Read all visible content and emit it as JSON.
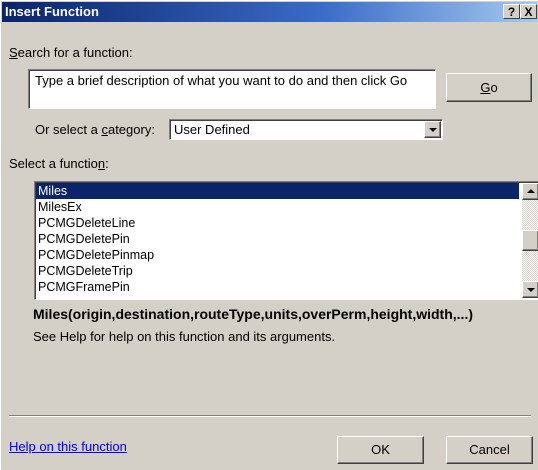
{
  "dialog": {
    "title": "Insert Function",
    "help_btn": "?",
    "close_btn": "X"
  },
  "search": {
    "label_accel": "S",
    "label_rest": "earch for a function:",
    "text": "Type a brief description of what you want to do and then click Go",
    "go_accel": "G",
    "go_rest": "o"
  },
  "category": {
    "label_pre": "Or select a ",
    "label_accel": "c",
    "label_post": "ategory:",
    "selected": "User Defined"
  },
  "functions": {
    "label_pre": "Select a functio",
    "label_accel": "n",
    "label_post": ":",
    "items": [
      "Miles",
      "MilesEx",
      "PCMGDeleteLine",
      "PCMGDeletePin",
      "PCMGDeletePinmap",
      "PCMGDeleteTrip",
      "PCMGFramePin"
    ],
    "selected_index": 0
  },
  "details": {
    "syntax": "Miles(origin,destination,routeType,units,overPerm,height,width,...)",
    "description": "See Help for help on this function and its arguments."
  },
  "footer": {
    "help_link": "Help on this function",
    "ok": "OK",
    "cancel": "Cancel"
  }
}
